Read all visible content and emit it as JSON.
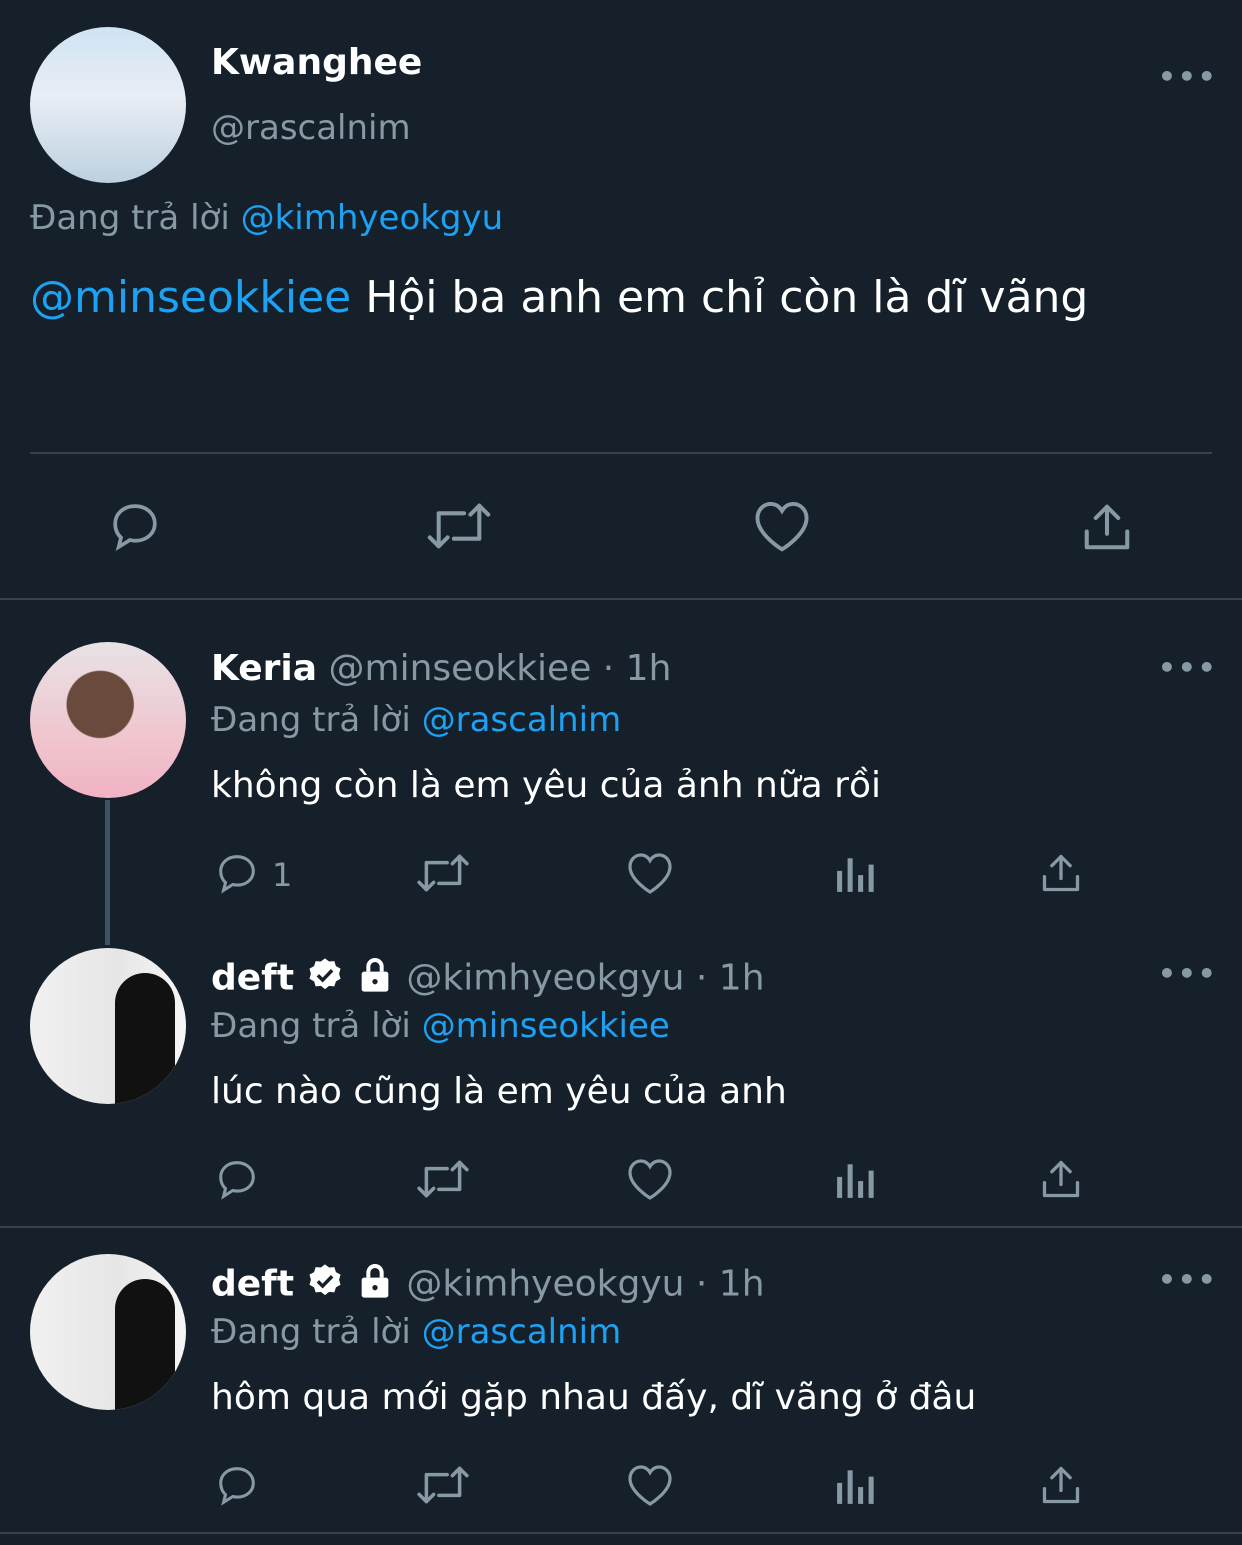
{
  "main_tweet": {
    "name": "Kwanghee",
    "handle": "@rascalnim",
    "reply_prefix": "Đang trả lời",
    "reply_to": "@kimhyeokgyu",
    "mention": "@minseokkiee",
    "text": "Hội ba anh em chỉ còn là dĩ vãng"
  },
  "replies": [
    {
      "name": "Keria",
      "handle": "@minseokkiee",
      "time": "· 1h",
      "reply_prefix": "Đang trả lời",
      "reply_to": "@rascalnim",
      "text": "không còn là em yêu của ảnh nữa rồi",
      "reply_count": "1"
    },
    {
      "name": "deft",
      "handle": "@kimhyeokgyu",
      "time": "· 1h",
      "reply_prefix": "Đang trả lời",
      "reply_to": "@minseokkiee",
      "text": "lúc nào cũng là em yêu của anh",
      "reply_count": ""
    },
    {
      "name": "deft",
      "handle": "@kimhyeokgyu",
      "time": "· 1h",
      "reply_prefix": "Đang trả lời",
      "reply_to": "@rascalnim",
      "text": "hôm qua mới gặp nhau đấy, dĩ vãng ở đâu",
      "reply_count": ""
    }
  ],
  "more_label": "•••",
  "colors": {
    "background": "#15202b",
    "link": "#1da1f2",
    "muted": "#8899a6",
    "divider": "#38444d"
  },
  "icons": [
    "reply-icon",
    "retweet-icon",
    "like-icon",
    "analytics-icon",
    "share-icon",
    "verified-icon",
    "lock-icon",
    "more-icon"
  ]
}
